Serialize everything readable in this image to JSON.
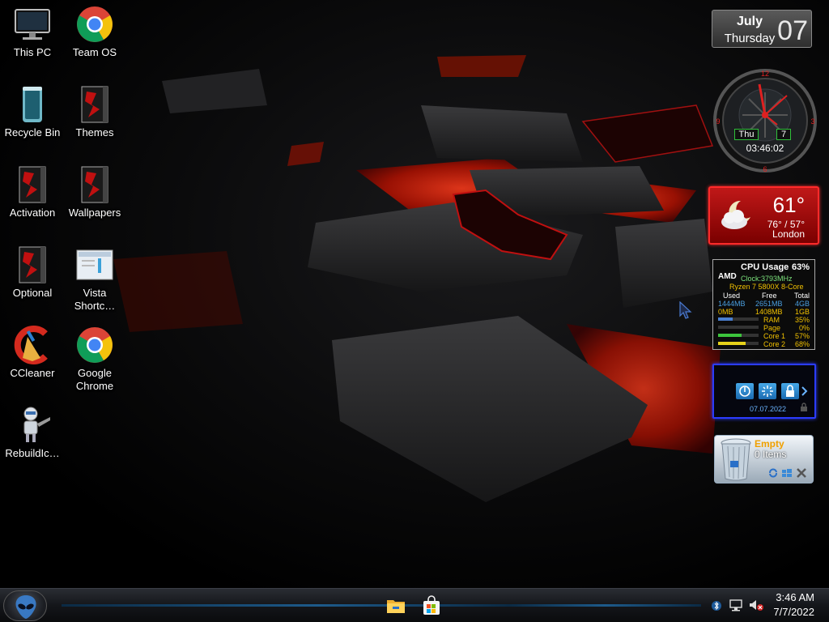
{
  "desktop_icons": [
    {
      "label": "This PC",
      "icon": "monitor-icon"
    },
    {
      "label": "Team OS",
      "icon": "chrome-icon"
    },
    {
      "label": "Recycle Bin",
      "icon": "recycle-bin-icon"
    },
    {
      "label": "Themes",
      "icon": "themes-icon"
    },
    {
      "label": "Activation",
      "icon": "activation-icon"
    },
    {
      "label": "Wallpapers",
      "icon": "wallpapers-icon"
    },
    {
      "label": "Optional",
      "icon": "optional-icon"
    },
    {
      "label": "Vista Shortc…",
      "icon": "shortcut-icon"
    },
    {
      "label": "CCleaner",
      "icon": "ccleaner-icon"
    },
    {
      "label": "Google Chrome",
      "icon": "chrome-icon"
    },
    {
      "label": "RebuildIc…",
      "icon": "robot-icon"
    }
  ],
  "calendar": {
    "month": "July",
    "weekday": "Thursday",
    "date": "07"
  },
  "clock": {
    "day": "Thu",
    "day_num": "7",
    "time": "03:46:02",
    "numerals": [
      "12",
      "3",
      "6",
      "9"
    ]
  },
  "weather": {
    "temp": "61°",
    "range": "76° / 57°",
    "city": "London"
  },
  "cpu_meter": {
    "brand": "AMD",
    "title": "CPU Usage",
    "usage": "63%",
    "clock": "Clock:3793MHz",
    "model": "Ryzen 7 5800X 8-Core",
    "headers": [
      "Used",
      "Free",
      "Total"
    ],
    "mem_rows": [
      [
        "1444MB",
        "2651MB",
        "4GB"
      ],
      [
        "0MB",
        "1408MB",
        "1GB"
      ]
    ],
    "stats": [
      {
        "name": "RAM",
        "value": "35%",
        "level": 0.35,
        "color": "#4a7fd0"
      },
      {
        "name": "Page",
        "value": "0%",
        "level": 0.0,
        "color": "#4a7fd0"
      },
      {
        "name": "Core 1",
        "value": "57%",
        "level": 0.57,
        "color": "#3cc43c"
      },
      {
        "name": "Core 2",
        "value": "68%",
        "level": 0.68,
        "color": "#e6d21a"
      }
    ]
  },
  "lock_gadget": {
    "date": "07.07.2022",
    "buttons": [
      "power-icon",
      "restart-icon",
      "lock-icon"
    ]
  },
  "recycle_gadget": {
    "status": "Empty",
    "items": "0 Items"
  },
  "taskbar": {
    "start_icon": "alien-logo-icon",
    "apps": [
      "file-explorer-icon",
      "store-icon"
    ],
    "time": "3:46 AM",
    "date": "7/7/2022",
    "tray_icons": [
      "network-icon",
      "volume-muted-icon",
      "bluetooth-icon"
    ]
  }
}
